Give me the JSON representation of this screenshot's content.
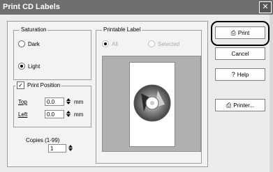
{
  "window": {
    "title": "Print CD Labels"
  },
  "saturation": {
    "title": "Saturation",
    "dark_label": "Dark",
    "light_label": "Light",
    "selected": "Light"
  },
  "printable_label": {
    "title": "Printable Label",
    "all_label": "All",
    "selected_label": "Selected",
    "enabled": false,
    "selected": "All"
  },
  "print_position": {
    "title": "Print Position",
    "checked": true,
    "top_label": "Top",
    "top_value": "0.0",
    "top_unit": "mm",
    "left_label": "Left",
    "left_value": "0.0",
    "left_unit": "mm"
  },
  "copies": {
    "label": "Copies (1-99)",
    "value": "1"
  },
  "buttons": {
    "print": "Print",
    "cancel": "Cancel",
    "help": "Help",
    "printer": "Printer..."
  },
  "icons": {
    "print": "printer-icon",
    "help": "question-icon",
    "printer": "printer-icon"
  },
  "colors": {
    "titlebar": "#6e6e6e",
    "preview_bg": "#b0b0b0"
  }
}
